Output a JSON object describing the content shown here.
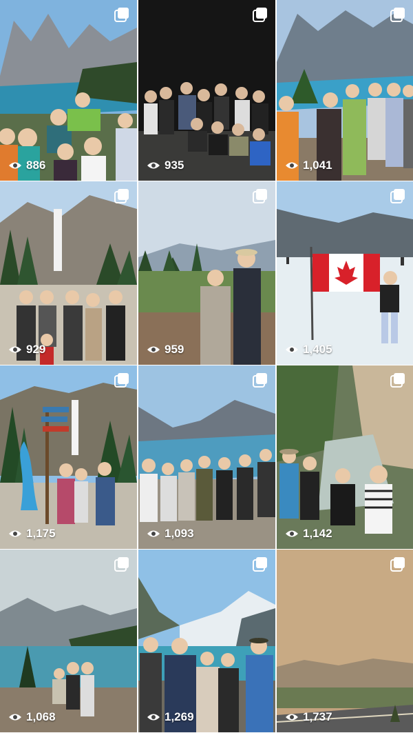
{
  "grid": {
    "posts": [
      {
        "views": "886",
        "scene": "lake-group"
      },
      {
        "views": "935",
        "scene": "night-group"
      },
      {
        "views": "1,041",
        "scene": "lookout-group"
      },
      {
        "views": "929",
        "scene": "waterfall-family"
      },
      {
        "views": "959",
        "scene": "couple-forest"
      },
      {
        "views": "1,405",
        "scene": "glacier-flag"
      },
      {
        "views": "1,175",
        "scene": "signpost-group"
      },
      {
        "views": "1,093",
        "scene": "lake-group-wide"
      },
      {
        "views": "1,142",
        "scene": "canyon-selfie"
      },
      {
        "views": "1,068",
        "scene": "moraine-rocks"
      },
      {
        "views": "1,269",
        "scene": "lake-louise-group"
      },
      {
        "views": "1,737",
        "scene": "smoky-valley"
      }
    ]
  },
  "icons": {
    "multi_photo": "carousel-icon",
    "views": "eye-icon"
  }
}
